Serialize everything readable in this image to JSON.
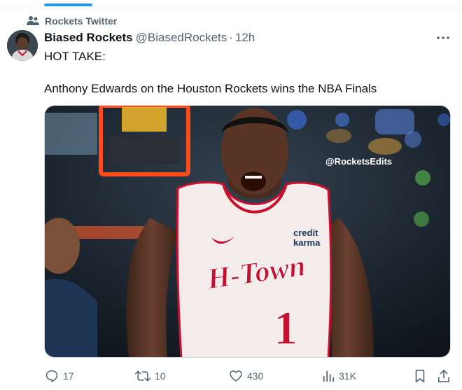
{
  "community": {
    "name": "Rockets Twitter",
    "icon": "people-icon"
  },
  "tweet": {
    "display_name": "Biased Rockets",
    "handle": "@BiasedRockets",
    "separator": "·",
    "time": "12h",
    "text_line_1": "HOT TAKE:",
    "text_line_2": "Anthony Edwards on the Houston Rockets wins the NBA Finals"
  },
  "media": {
    "watermark": "@RocketsEdits",
    "jersey_wordmark": "H-Town",
    "jersey_number": "1",
    "sponsor_line1": "credit",
    "sponsor_line2": "karma"
  },
  "actions": {
    "replies": "17",
    "reposts": "10",
    "likes": "430",
    "views": "31K"
  },
  "colors": {
    "accent": "#1d9bf0",
    "muted": "#536471",
    "text": "#0f1419",
    "jersey_red": "#c8102e"
  }
}
